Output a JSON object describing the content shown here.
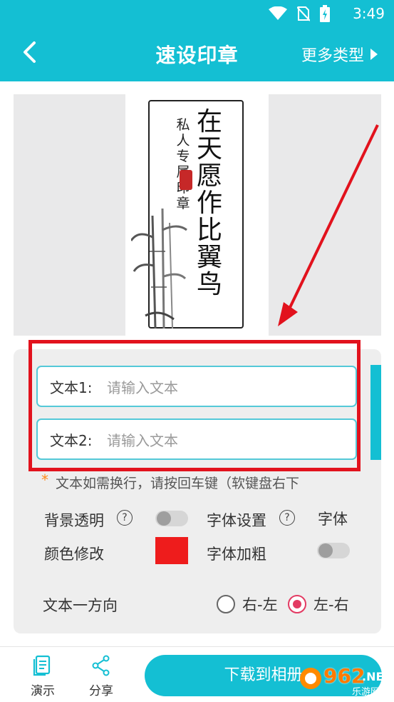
{
  "status_bar": {
    "time": "3:49",
    "icons": [
      "wifi-icon",
      "no-sim-icon",
      "battery-charging-icon"
    ]
  },
  "header": {
    "title": "速设印章",
    "more_types": "更多类型"
  },
  "preview": {
    "seal_main_text": "在天愿作比翼鸟",
    "seal_sub_text": "私人专属印章"
  },
  "form": {
    "text1_label": "文本1:",
    "text1_placeholder": "请输入文本",
    "text2_label": "文本2:",
    "text2_placeholder": "请输入文本",
    "hint_star": "*",
    "hint": "文本如需换行，请按回车键（软键盘右下",
    "background_transparent": "背景透明",
    "font_settings": "字体设置",
    "font": "字体",
    "color_edit": "颜色修改",
    "font_bold": "字体加粗",
    "text_direction": "文本一方向",
    "direction_options": [
      "右-左",
      "左-右"
    ],
    "selected_direction": "左-右",
    "swatch_color": "#ee1c1c"
  },
  "bottom": {
    "demo": "演示",
    "share": "分享",
    "download": "下载到相册"
  },
  "watermark": {
    "number": "962",
    "net": ".NET",
    "name": "乐游网"
  },
  "colors": {
    "accent": "#14bfd3",
    "annotation": "#e2121d",
    "radio_checked": "#e33b63"
  }
}
